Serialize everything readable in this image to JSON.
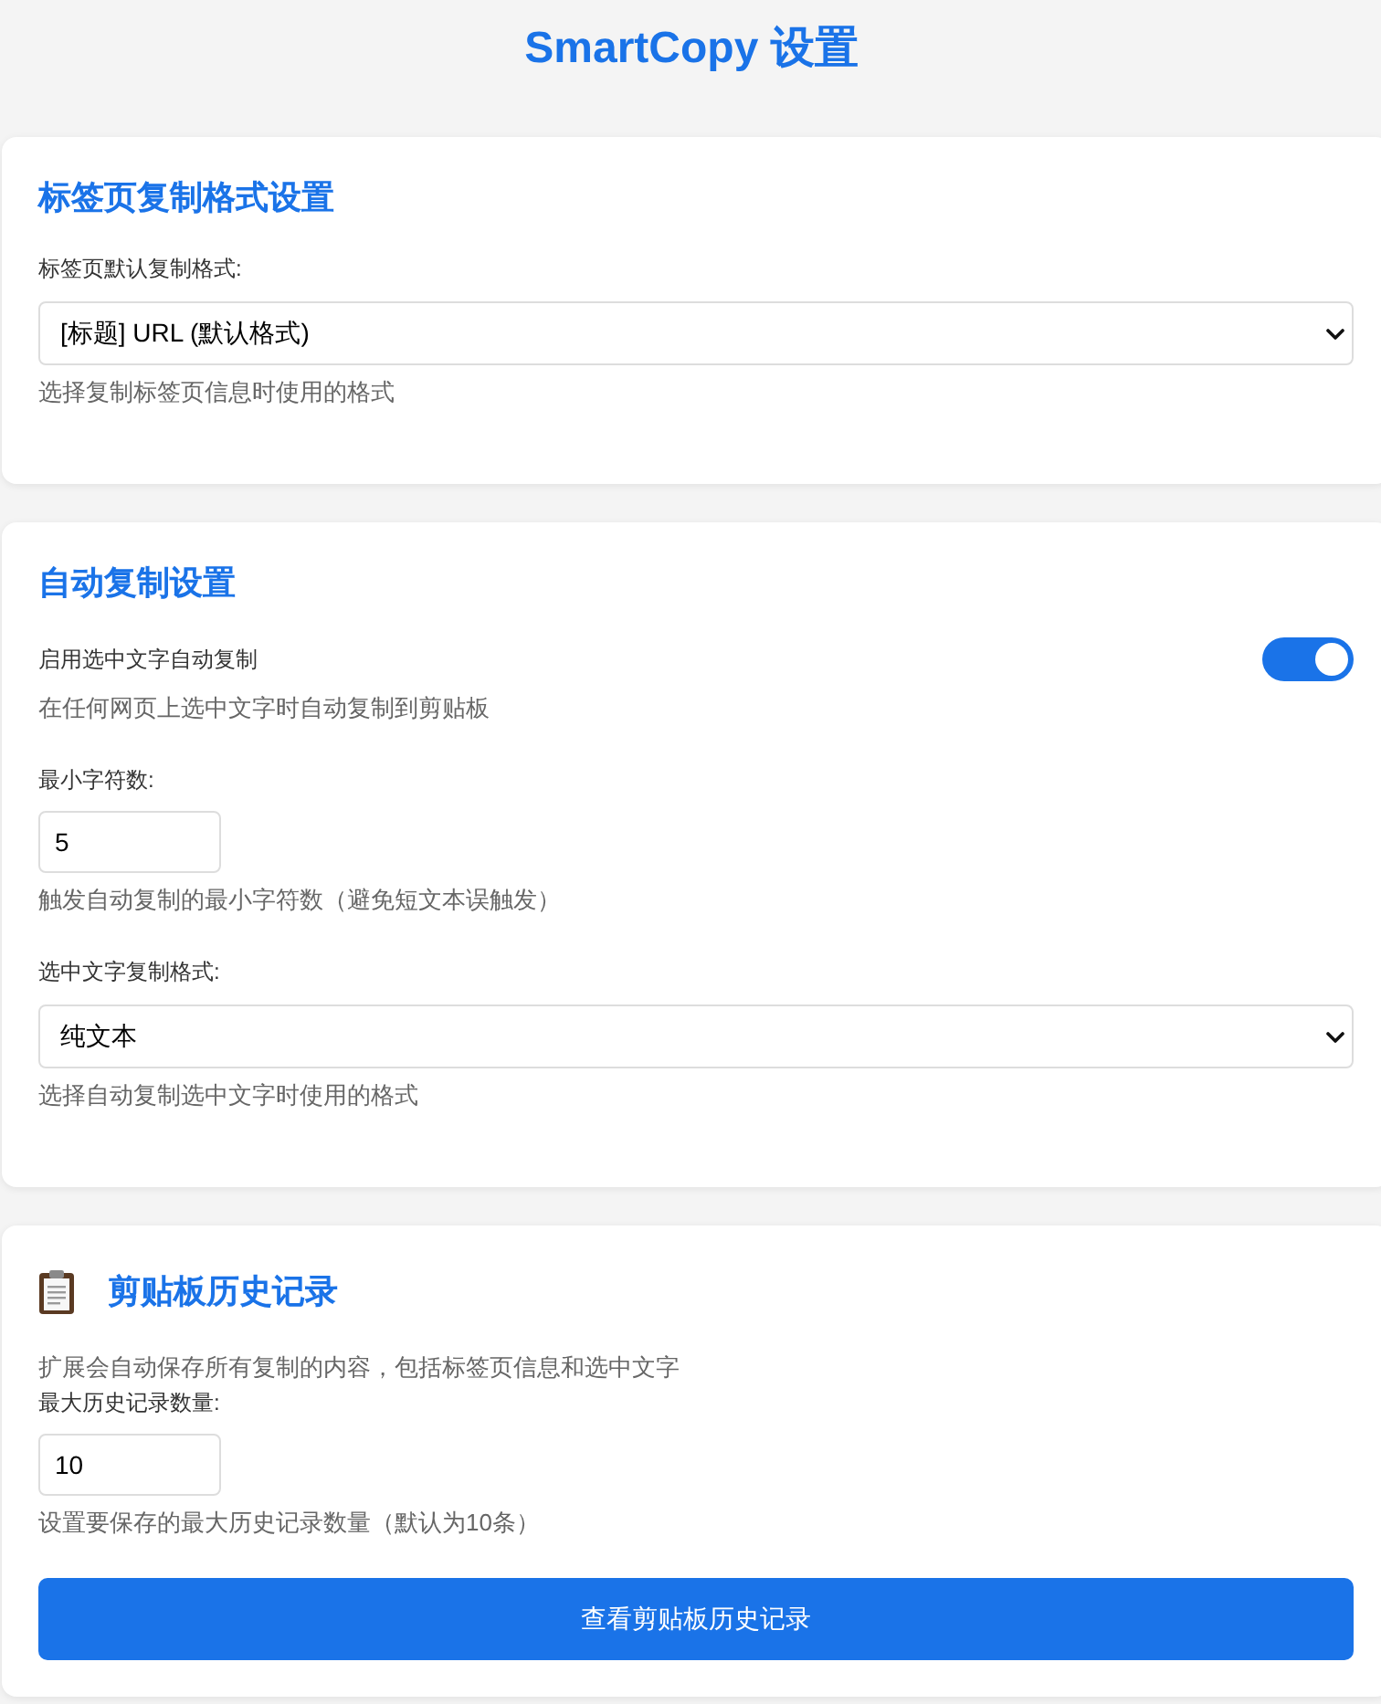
{
  "title": "SmartCopy 设置",
  "sections": [
    {
      "heading": "标签页复制格式设置",
      "icon": false,
      "fields": [
        {
          "kind": "select",
          "label": "标签页默认复制格式:",
          "value": "[标题] URL (默认格式)",
          "hint": "选择复制标签页信息时使用的格式"
        }
      ]
    },
    {
      "heading": "自动复制设置",
      "icon": false,
      "fields": [
        {
          "kind": "toggle",
          "label": "启用选中文字自动复制",
          "on": true,
          "hint": "在任何网页上选中文字时自动复制到剪贴板"
        },
        {
          "kind": "number",
          "label": "最小字符数:",
          "value": "5",
          "hint": "触发自动复制的最小字符数（避免短文本误触发）"
        },
        {
          "kind": "select",
          "label": "选中文字复制格式:",
          "value": "纯文本",
          "hint": "选择自动复制选中文字时使用的格式"
        }
      ]
    },
    {
      "heading": "剪贴板历史记录",
      "icon": true,
      "description": "扩展会自动保存所有复制的内容，包括标签页信息和选中文字",
      "fields": [
        {
          "kind": "number",
          "label": "最大历史记录数量:",
          "value": "10",
          "hint": "设置要保存的最大历史记录数量（默认为10条）"
        },
        {
          "kind": "button",
          "label": "查看剪贴板历史记录"
        }
      ]
    }
  ]
}
